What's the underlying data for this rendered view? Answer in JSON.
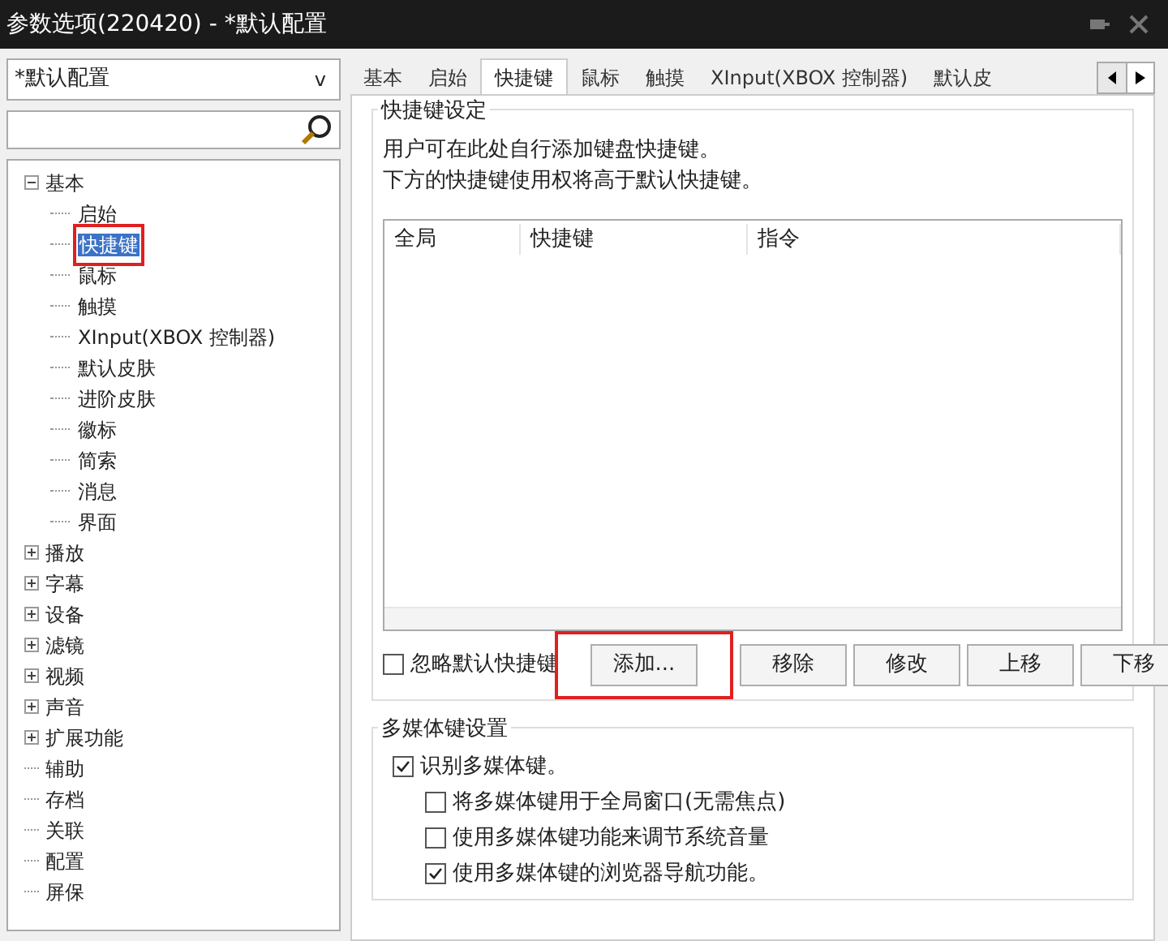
{
  "window": {
    "title": "参数选项(220420) - *默认配置"
  },
  "profile_dropdown": {
    "value": "*默认配置",
    "caret": "v"
  },
  "tree": [
    {
      "label": "基本",
      "expanded": true,
      "children": [
        {
          "label": "启始",
          "selected": false,
          "highlighted": false
        },
        {
          "label": "快捷键",
          "selected": true,
          "highlighted": true
        },
        {
          "label": "鼠标",
          "selected": false,
          "highlighted": false
        },
        {
          "label": "触摸",
          "selected": false,
          "highlighted": false
        },
        {
          "label": "XInput(XBOX 控制器)",
          "selected": false,
          "highlighted": false
        },
        {
          "label": "默认皮肤",
          "selected": false,
          "highlighted": false
        },
        {
          "label": "进阶皮肤",
          "selected": false,
          "highlighted": false
        },
        {
          "label": "徽标",
          "selected": false,
          "highlighted": false
        },
        {
          "label": "简索",
          "selected": false,
          "highlighted": false
        },
        {
          "label": "消息",
          "selected": false,
          "highlighted": false
        },
        {
          "label": "界面",
          "selected": false,
          "highlighted": false
        }
      ]
    },
    {
      "label": "播放",
      "expanded": false
    },
    {
      "label": "字幕",
      "expanded": false
    },
    {
      "label": "设备",
      "expanded": false
    },
    {
      "label": "滤镜",
      "expanded": false
    },
    {
      "label": "视频",
      "expanded": false
    },
    {
      "label": "声音",
      "expanded": false
    },
    {
      "label": "扩展功能",
      "expanded": false
    },
    {
      "label": "辅助"
    },
    {
      "label": "存档"
    },
    {
      "label": "关联"
    },
    {
      "label": "配置"
    },
    {
      "label": "屏保"
    }
  ],
  "tabs": [
    {
      "label": "基本",
      "selected": false
    },
    {
      "label": "启始",
      "selected": false
    },
    {
      "label": "快捷键",
      "selected": true
    },
    {
      "label": "鼠标",
      "selected": false
    },
    {
      "label": "触摸",
      "selected": false
    },
    {
      "label": "XInput(XBOX 控制器)",
      "selected": false
    },
    {
      "label": "默认皮",
      "selected": false
    }
  ],
  "hotkey_group": {
    "title": "快捷键设定",
    "description": [
      "用户可在此处自行添加键盘快捷键。",
      "下方的快捷键使用权将高于默认快捷键。"
    ],
    "table": {
      "columns": [
        "全局",
        "快捷键",
        "指令"
      ]
    },
    "ignore_default": {
      "label": "忽略默认快捷键",
      "checked": false
    },
    "buttons": [
      {
        "label": "添加...",
        "highlighted": true
      },
      {
        "label": "移除",
        "highlighted": false
      },
      {
        "label": "修改",
        "highlighted": false
      },
      {
        "label": "上移",
        "highlighted": false
      },
      {
        "label": "下移",
        "highlighted": false
      }
    ]
  },
  "multimedia_group": {
    "title": "多媒体键设置",
    "options": [
      {
        "label": "识别多媒体键。",
        "checked": true,
        "indented": false
      },
      {
        "label": "将多媒体键用于全局窗口(无需焦点)",
        "checked": false,
        "indented": true
      },
      {
        "label": "使用多媒体键功能来调节系统音量",
        "checked": false,
        "indented": true
      },
      {
        "label": "使用多媒体键的浏览器导航功能。",
        "checked": true,
        "indented": true
      }
    ]
  }
}
